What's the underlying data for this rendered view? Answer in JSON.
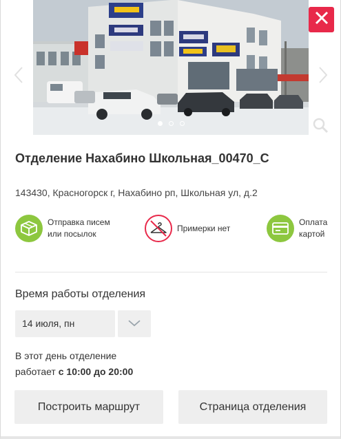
{
  "gallery": {
    "slide_count": 3,
    "active_slide": 1,
    "prev_icon": "chevron-left-icon",
    "next_icon": "chevron-right-icon",
    "zoom_icon": "magnifier-icon",
    "photo_sign_texts": [
      "О'КЕЙ",
      "ЛЕНТА",
      "ДЕТСКИЙ МИР",
      "ЛЕНТА"
    ]
  },
  "close": {
    "icon": "close-icon",
    "color": "#e8294a"
  },
  "office": {
    "title": "Отделение Нахабино Школьная_00470_С",
    "address": "143430, Красногорск г, Нахабино рп, Школьная ул, д.2"
  },
  "features": [
    {
      "icon": "parcel-box-icon",
      "label_line1": "Отправка писем",
      "label_line2": "или посылок",
      "color": "#8dc73f"
    },
    {
      "icon": "no-fitting-hanger-icon",
      "label_line1": "Примерки нет",
      "label_line2": "",
      "color": "#e8294a"
    },
    {
      "icon": "card-payment-icon",
      "label_line1": "Оплата",
      "label_line2": "картой",
      "color": "#8dc73f"
    }
  ],
  "hours": {
    "title": "Время работы отделения",
    "selected_date": "14 июля, пн",
    "day_text_line1": "В этот день отделение",
    "day_text_line2_prefix": "работает ",
    "day_hours": "с 10:00 до 20:00"
  },
  "actions": {
    "route_label": "Построить маршрут",
    "office_page_label": "Страница отделения"
  }
}
